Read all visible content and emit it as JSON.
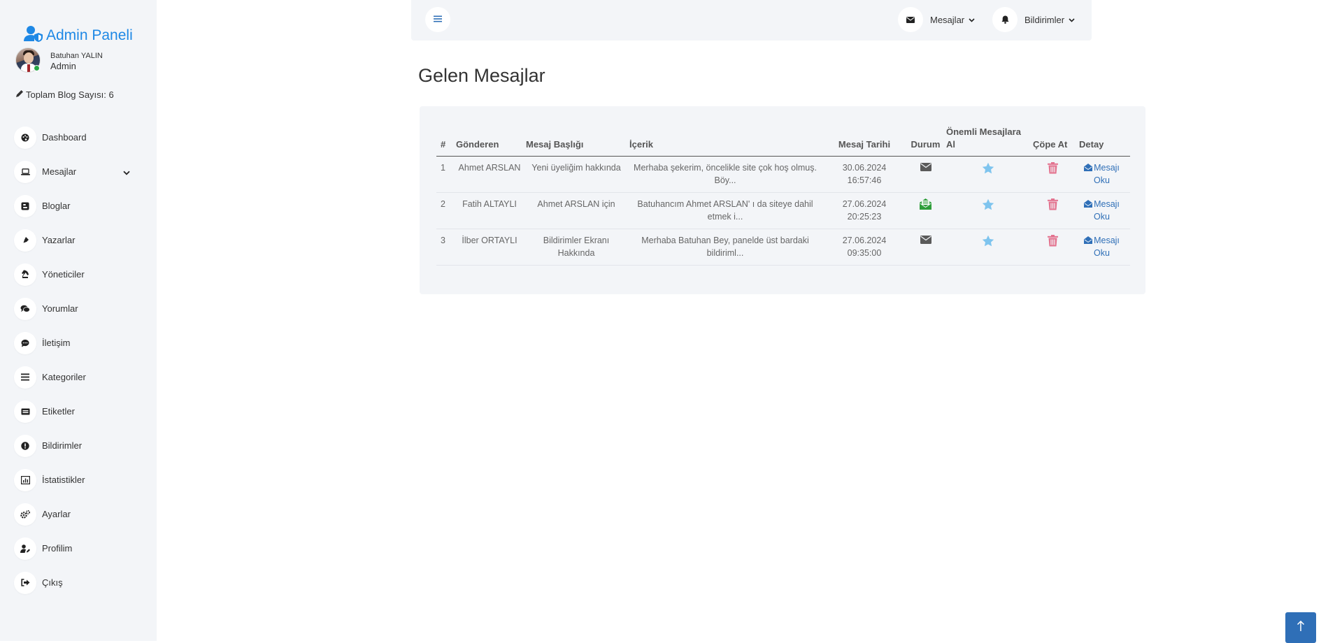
{
  "brand": {
    "title": "Admin Paneli",
    "icon": "user-shield-icon",
    "color": "#1e88e5"
  },
  "user": {
    "name": "Batuhan YALIN",
    "role": "Admin",
    "status": "online"
  },
  "blog_count": {
    "text": "Toplam Blog Sayısı: 6",
    "icon": "pencil-icon"
  },
  "sidebar": {
    "items": [
      {
        "label": "Dashboard",
        "icon": "palette-icon"
      },
      {
        "label": "Mesajlar",
        "icon": "laptop-icon",
        "has_submenu": true
      },
      {
        "label": "Bloglar",
        "icon": "blogger-icon"
      },
      {
        "label": "Yazarlar",
        "icon": "pen-nib-icon"
      },
      {
        "label": "Yöneticiler",
        "icon": "chess-knight-icon"
      },
      {
        "label": "Yorumlar",
        "icon": "comments-icon"
      },
      {
        "label": "İletişim",
        "icon": "comment-dots-icon"
      },
      {
        "label": "Kategoriler",
        "icon": "list-icon"
      },
      {
        "label": "Etiketler",
        "icon": "rectangle-list-icon"
      },
      {
        "label": "Bildirimler",
        "icon": "exclamation-circle-icon"
      },
      {
        "label": "İstatistikler",
        "icon": "chart-icon"
      },
      {
        "label": "Ayarlar",
        "icon": "gears-icon"
      },
      {
        "label": "Profilim",
        "icon": "user-pen-icon"
      },
      {
        "label": "Çıkış",
        "icon": "sign-out-icon"
      }
    ]
  },
  "topbar": {
    "messages_label": "Mesajlar",
    "notifications_label": "Bildirimler"
  },
  "page": {
    "title": "Gelen Mesajlar"
  },
  "table": {
    "headers": {
      "num": "#",
      "sender": "Gönderen",
      "subject": "Mesaj Başlığı",
      "content": "İçerik",
      "date": "Mesaj Tarihi",
      "status": "Durum",
      "important": "Önemli Mesajlara Al",
      "trash": "Çöpe At",
      "detail": "Detay"
    },
    "rows": [
      {
        "num": "1",
        "sender": "Ahmet ARSLAN",
        "subject": "Yeni üyeliğim hakkında",
        "content": "Merhaba şekerim, öncelikle site çok hoş olmuş. Böy...",
        "date": "30.06.2024",
        "time": "16:57:46",
        "status": "unread",
        "detail": "Mesajı Oku"
      },
      {
        "num": "2",
        "sender": "Fatih ALTAYLI",
        "subject": "Ahmet ARSLAN için",
        "content": "Batuhancım Ahmet ARSLAN' ı da siteye dahil etmek i...",
        "date": "27.06.2024",
        "time": "20:25:23",
        "status": "read",
        "detail": "Mesajı Oku"
      },
      {
        "num": "3",
        "sender": "İlber ORTAYLI",
        "subject": "Bildirimler Ekranı Hakkında",
        "content": "Merhaba Batuhan Bey, panelde üst bardaki bildiriml...",
        "date": "27.06.2024",
        "time": "09:35:00",
        "status": "unread",
        "detail": "Mesajı Oku"
      }
    ]
  },
  "colors": {
    "sidebar_bg": "#f3f5f8",
    "star": "#7ec4ee",
    "trash": "#e3738f",
    "read_status": "#2e9e3a",
    "link": "#2f6fb7"
  }
}
